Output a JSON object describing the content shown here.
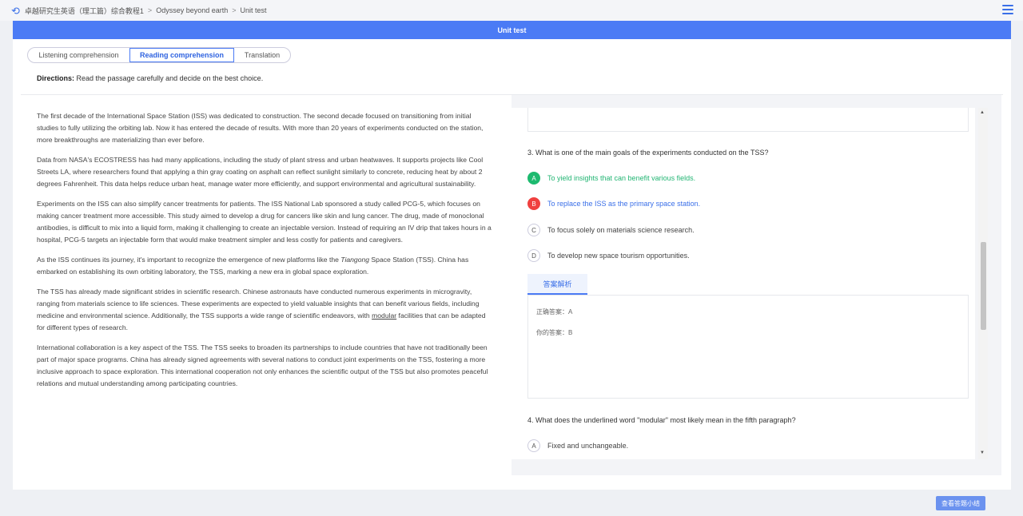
{
  "breadcrumb": {
    "course": "卓越研究生英语（理工篇）综合教程1",
    "unit": "Odyssey beyond earth",
    "page": "Unit test"
  },
  "header": {
    "title": "Unit test"
  },
  "tabs": [
    "Listening comprehension",
    "Reading comprehension",
    "Translation"
  ],
  "directions": {
    "label": "Directions:",
    "text": "Read the passage carefully and decide on the best choice."
  },
  "passage": {
    "p1": "The first decade of the International Space Station (ISS) was dedicated to construction. The second decade focused on transitioning from initial studies to fully utilizing the orbiting lab. Now it has entered the decade of results. With more than 20 years of experiments conducted on the station, more breakthroughs are materializing than ever before.",
    "p2": "Data from NASA's ECOSTRESS has had many applications, including the study of plant stress and urban heatwaves. It supports projects like Cool Streets LA, where researchers found that applying a thin gray coating on asphalt can reflect sunlight similarly to concrete, reducing heat by about 2 degrees Fahrenheit. This data helps reduce urban heat, manage water more efficiently, and support environmental and agricultural sustainability.",
    "p3": "Experiments on the ISS can also simplify cancer treatments for patients. The ISS National Lab sponsored a study called PCG-5, which focuses on making cancer treatment more accessible. This study aimed to develop a drug for cancers like skin and lung cancer. The drug, made of monoclonal antibodies, is difficult to mix into a liquid form, making it challenging to create an injectable version. Instead of requiring an IV drip that takes hours in a hospital, PCG-5 targets an injectable form that would make treatment simpler and less costly for patients and caregivers.",
    "p4_a": "As the ISS continues its journey, it's important to recognize the emergence of new platforms like the ",
    "p4_italic": "Tiangong",
    "p4_b": " Space Station (TSS). China has embarked on establishing its own orbiting laboratory, the TSS, marking a new era in global space exploration.",
    "p5_a": "The TSS has already made significant strides in scientific research. Chinese astronauts have conducted numerous experiments in microgravity, ranging from materials science to life sciences. These experiments are expected to yield valuable insights that can benefit various fields, including medicine and environmental science. Additionally, the TSS supports a wide range of scientific endeavors, with ",
    "p5_underlined": "modular",
    "p5_b": " facilities that can be adapted for different types of research.",
    "p6": "International collaboration is a key aspect of the TSS. The TSS seeks to broaden its partnerships to include countries that have not traditionally been part of major space programs. China has already signed agreements with several nations to conduct joint experiments on the TSS, fostering a more inclusive approach to space exploration. This international cooperation not only enhances the scientific output of the TSS but also promotes peaceful relations and mutual understanding among participating countries."
  },
  "q3": {
    "text": "3. What is one of the main goals of the experiments conducted on the TSS?",
    "options": [
      {
        "letter": "A",
        "text": "To yield insights that can benefit various fields.",
        "state": "correct"
      },
      {
        "letter": "B",
        "text": "To replace the ISS as the primary space station.",
        "state": "selected-wrong"
      },
      {
        "letter": "C",
        "text": "To focus solely on materials science research.",
        "state": "none"
      },
      {
        "letter": "D",
        "text": "To develop new space tourism opportunities.",
        "state": "none"
      }
    ]
  },
  "analysis": {
    "tab_label": "答案解析",
    "correct_line": "正确答案：A",
    "yours_line": "你的答案：B"
  },
  "q4": {
    "text": "4. What does the underlined word \"modular\" most likely mean in the fifth paragraph?",
    "options": [
      {
        "letter": "A",
        "text": "Fixed and unchangeable."
      }
    ]
  },
  "footer": {
    "summary_button": "查看答题小结"
  },
  "colors": {
    "accent": "#4b7bf5",
    "correct": "#1dba6f",
    "wrong": "#f0403f"
  }
}
